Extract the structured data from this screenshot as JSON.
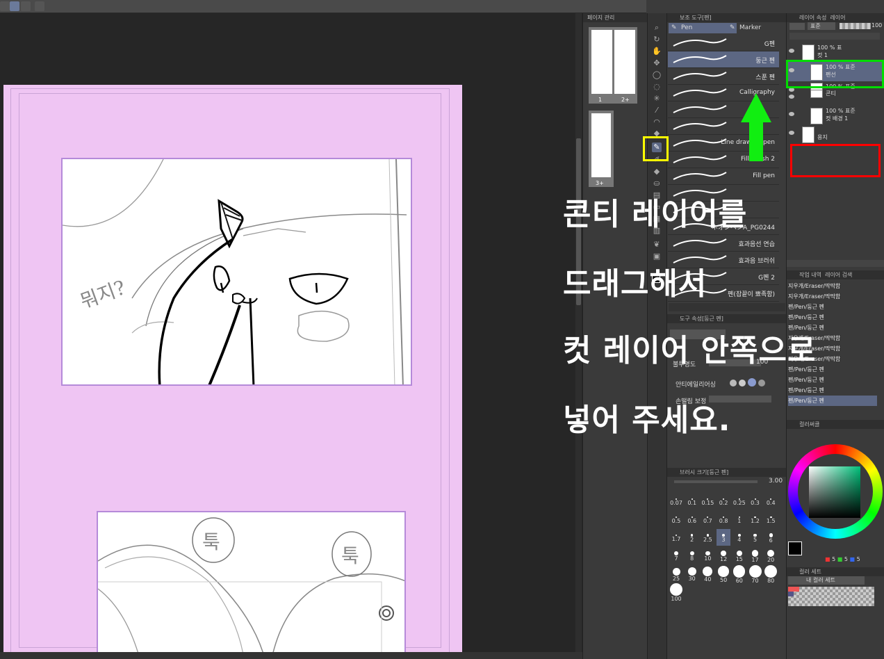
{
  "colors": {
    "highlight_yellow": "#ffff00",
    "highlight_green": "#00dd00",
    "highlight_red": "#ff0000",
    "arrow": "#11ee11",
    "page_bg": "#efc5f3",
    "selection": "#5c6783"
  },
  "navigator": {
    "title": "페이지 관리",
    "pages": [
      {
        "label": "1"
      },
      {
        "label": "2+"
      },
      {
        "label": "3+"
      }
    ]
  },
  "subtool": {
    "title": "보조 도구[펜]",
    "tabs": [
      {
        "label": "Pen",
        "icon": "pen-icon"
      },
      {
        "label": "Marker",
        "icon": "marker-icon"
      }
    ],
    "brushes": [
      "G펜",
      "둥근 펜",
      "스푼 펜",
      "Calligraphy",
      "",
      "",
      "Line drawing pen",
      "Fill brush 2",
      "Fill pen",
      "",
      "",
      "ネオンペンA_PG0244",
      "효과음선 연습",
      "효과음 브러쉬",
      "G펜 2",
      "펜(잡끝이 뾰족함)"
    ],
    "selected_brush": 1
  },
  "tool_property": {
    "title": "도구 속성[둥근 펜]",
    "rows": [
      {
        "label": "불투명도",
        "value": "100"
      },
      {
        "label": "안티에일리어싱",
        "value": ""
      },
      {
        "label": "손떨림 보정",
        "value": ""
      }
    ]
  },
  "brush_size": {
    "title": "브러시 크기[둥근 펜]",
    "value": "3.00",
    "sizes": [
      "0.07",
      "0.1",
      "0.15",
      "0.2",
      "0.25",
      "0.3",
      "0.4",
      "0.5",
      "0.6",
      "0.7",
      "0.8",
      "1",
      "1.2",
      "1.5",
      "1.7",
      "2",
      "2.5",
      "3",
      "4",
      "5",
      "6",
      "7",
      "8",
      "10",
      "12",
      "15",
      "17",
      "20",
      "25",
      "30",
      "40",
      "50",
      "60",
      "70",
      "80",
      "100"
    ],
    "selected": "3"
  },
  "layers": {
    "tabs": [
      "레이어 속성",
      "레이어"
    ],
    "blend": "표준",
    "opacity": "100",
    "items": [
      {
        "name": "컷 1",
        "mode": "100 % 표",
        "selected": false
      },
      {
        "name": "펜선",
        "mode": "100 % 표준",
        "selected": true
      },
      {
        "name": "",
        "mode": "100 % 표준",
        "selected": false
      },
      {
        "name": "콘티",
        "mode": "",
        "selected": false
      },
      {
        "name": "컷 배경 1",
        "mode": "100 % 표준",
        "selected": false
      },
      {
        "name": "용지",
        "mode": "",
        "selected": false
      }
    ]
  },
  "history": {
    "tabs": [
      "작업 내역",
      "레이어 검색"
    ],
    "items": [
      "지우개/Eraser/딱딱함",
      "지우개/Eraser/딱딱함",
      "펜/Pen/둥근 펜",
      "펜/Pen/둥근 펜",
      "펜/Pen/둥근 펜",
      "지우개/Eraser/딱딱함",
      "지우개/Eraser/딱딱함",
      "지우개/Eraser/딱딱함",
      "펜/Pen/둥근 펜",
      "펜/Pen/둥근 펜",
      "펜/Pen/둥근 펜",
      "펜/Pen/둥근 펜"
    ]
  },
  "color_wheel": {
    "title": "컬러써클",
    "rgb": [
      "5",
      "5",
      "5"
    ]
  },
  "color_set": {
    "title": "컬러 세트",
    "name": "내 컬러 세트"
  },
  "canvas_text": {
    "cut1_text": "뭐지?",
    "bubble1": "툭",
    "bubble2": "툭"
  },
  "instruction": {
    "lines": [
      "콘티 레이어를",
      "드래그해서",
      "컷 레이어 안쪽으로",
      "넣어 주세요."
    ]
  },
  "percent_label": "100 %"
}
